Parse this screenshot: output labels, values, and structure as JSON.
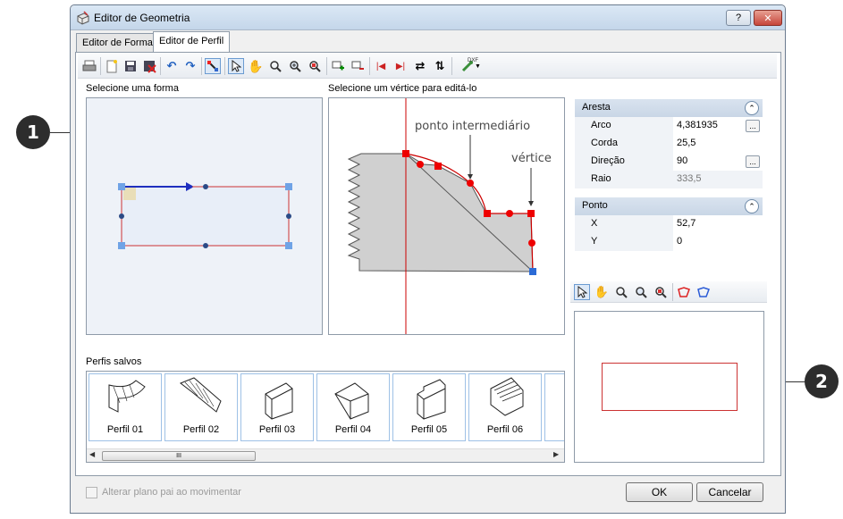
{
  "callouts": [
    "1",
    "2"
  ],
  "window": {
    "title": "Editor de Geometria",
    "help_label": "?",
    "close_label": "✕"
  },
  "tabs": [
    {
      "label": "Editor de Forma",
      "active": false
    },
    {
      "label": "Editor de Perfil",
      "active": true
    }
  ],
  "toolbar": {
    "icons": [
      "print-icon",
      "new-icon",
      "save-icon",
      "delete-icon",
      "undo-icon",
      "redo-icon",
      "edit-vertex-icon",
      "select-icon",
      "pan-icon",
      "zoom-icon",
      "zoom-in-icon",
      "zoom-fit-icon",
      "add-vertex-icon",
      "remove-vertex-icon",
      "first-icon",
      "last-icon",
      "reverse-icon",
      "flip-icon",
      "dxf-export-icon"
    ],
    "dxf_label": "DXF"
  },
  "shape_panel": {
    "label": "Selecione uma forma"
  },
  "vertex_panel": {
    "label": "Selecione um vértice para editá-lo",
    "annotation_mid": "ponto intermediário",
    "annotation_vertex": "vértice"
  },
  "properties": {
    "aresta": {
      "header": "Aresta",
      "rows": [
        {
          "key": "Arco",
          "value": "4,381935",
          "has_button": true,
          "readonly": false
        },
        {
          "key": "Corda",
          "value": "25,5",
          "has_button": false,
          "readonly": false
        },
        {
          "key": "Direção",
          "value": "90",
          "has_button": true,
          "readonly": false
        },
        {
          "key": "Raio",
          "value": "333,5",
          "has_button": false,
          "readonly": true
        }
      ]
    },
    "ponto": {
      "header": "Ponto",
      "rows": [
        {
          "key": "X",
          "value": "52,7"
        },
        {
          "key": "Y",
          "value": "0"
        }
      ]
    },
    "button_label": "..."
  },
  "saved_profiles": {
    "label": "Perfis salvos",
    "items": [
      "Perfil 01",
      "Perfil 02",
      "Perfil 03",
      "Perfil 04",
      "Perfil 05",
      "Perfil 06"
    ],
    "scroll_label": "III"
  },
  "footer": {
    "checkbox_label": "Alterar plano pai ao movimentar",
    "checkbox_checked": false,
    "ok_label": "OK",
    "cancel_label": "Cancelar"
  },
  "colors": {
    "accent": "#cc0000",
    "selection_blue": "#3366cc",
    "panel_bg": "#eef2f8"
  }
}
